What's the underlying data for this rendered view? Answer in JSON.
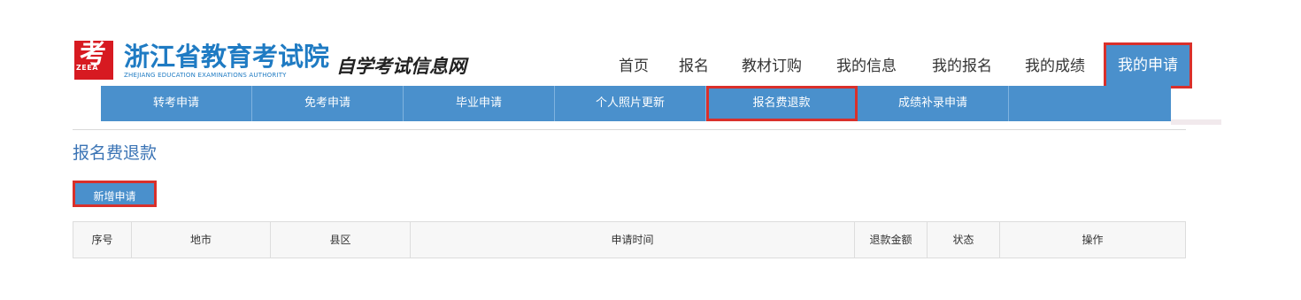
{
  "logo": {
    "glyph": "考",
    "abbr": "ZEEA",
    "cn": "浙江省教育考试院",
    "en": "ZHEJIANG EDUCATION EXAMINATIONS AUTHORITY",
    "sub": "自学考试信息网"
  },
  "topnav": [
    "首页",
    "报名",
    "教材订购",
    "我的信息",
    "我的报名",
    "我的成绩",
    "我的申请"
  ],
  "subnav": [
    "转考申请",
    "免考申请",
    "毕业申请",
    "个人照片更新",
    "报名费退款",
    "成绩补录申请",
    ""
  ],
  "page_title": "报名费退款",
  "add_button": "新增申请",
  "table": {
    "headers": [
      "序号",
      "地市",
      "县区",
      "申请时间",
      "退款金额",
      "状态",
      "操作"
    ]
  },
  "colors": {
    "accent": "#4a90cc",
    "highlight_border": "#d9302b",
    "logo_red": "#d71a21",
    "logo_blue": "#1f7bc3"
  }
}
